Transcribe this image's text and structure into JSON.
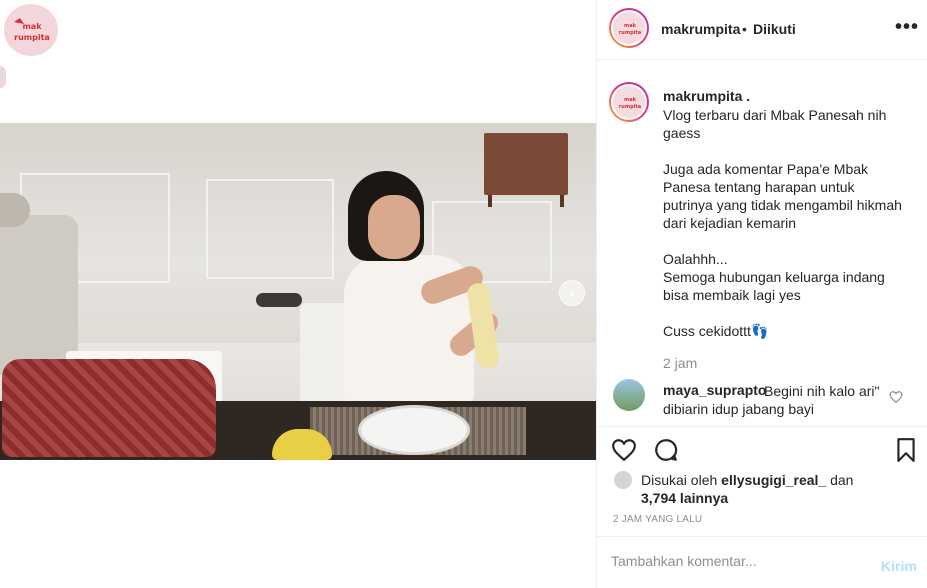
{
  "post": {
    "username": "makrumpita",
    "separator": "•",
    "follow_status": "Diikuti",
    "more_label": "•••"
  },
  "logo_text": "mak rumpita",
  "caption": {
    "username": "makrumpita .",
    "text": "Vlog terbaru dari Mbak Panesah nih gaess\n\nJuga ada komentar Papa'e Mbak Panesa tentang harapan untuk putrinya yang tidak mengambil hikmah dari kejadian kemarin\n\nOalahhh...\nSemoga hubungan keluarga indang bisa membaik lagi yes\n\nCuss cekidottt",
    "emoji": "👣",
    "time": "2 jam"
  },
  "comment": {
    "username": "maya_suprapto",
    "text": "Begini nih kalo ari\" dibiarin idup jabang bayi"
  },
  "likes": {
    "prefix": "Disukai oleh",
    "user": "ellysugigi_real_",
    "middle": "dan",
    "count": "3,794 lainnya"
  },
  "timestamp_caps": "2 JAM YANG LALU",
  "input": {
    "placeholder": "Tambahkan komentar...",
    "send_label": "Kirim"
  },
  "icons": {
    "like": "heart-icon",
    "comment": "comment-icon",
    "save": "bookmark-icon",
    "next": "chevron-right-icon"
  },
  "colors": {
    "story_ring_start": "#f7b13a",
    "story_ring_end": "#b42fb8",
    "send_disabled": "#b2dffc",
    "muted": "#8e8e8e"
  }
}
